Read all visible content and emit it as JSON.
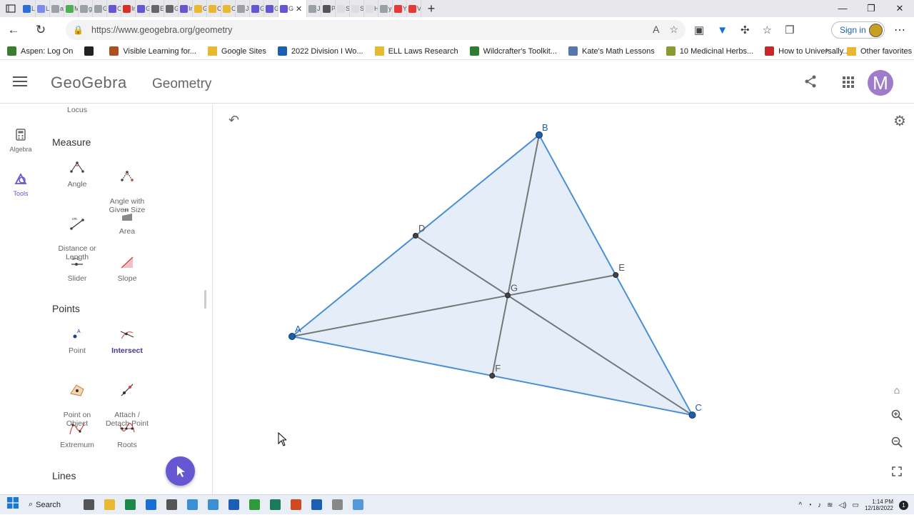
{
  "browser": {
    "tabs": [
      {
        "label": "Li",
        "color": "#2a6fd6"
      },
      {
        "label": "Li",
        "color": "#7a8cf0"
      },
      {
        "label": "ai",
        "color": "#9aa0a6"
      },
      {
        "label": "M",
        "color": "#4caf50"
      },
      {
        "label": "gi",
        "color": "#9aa0a6"
      },
      {
        "label": "G",
        "color": "#9aa0a6"
      },
      {
        "label": "Cl",
        "color": "#6557d2"
      },
      {
        "label": "In",
        "color": "#d93025"
      },
      {
        "label": "G",
        "color": "#6557d2"
      },
      {
        "label": "Ei",
        "color": "#666666"
      },
      {
        "label": "G",
        "color": "#666666"
      },
      {
        "label": "Ir",
        "color": "#6557d2"
      },
      {
        "label": "G",
        "color": "#e8b830"
      },
      {
        "label": "C",
        "color": "#e8b830"
      },
      {
        "label": "C",
        "color": "#e8b830"
      },
      {
        "label": "Jc",
        "color": "#9aa0a6"
      },
      {
        "label": "G",
        "color": "#6557d2"
      },
      {
        "label": "G",
        "color": "#6557d2"
      }
    ],
    "active_tab": {
      "label": "G",
      "close": "✕"
    },
    "tabs_after": [
      {
        "label": "Jc",
        "color": "#9aa0a6"
      },
      {
        "label": "Pi",
        "color": "#555555"
      },
      {
        "label": "S",
        "color": "#dddddd"
      },
      {
        "label": "S",
        "color": "#dddddd"
      },
      {
        "label": "H",
        "color": "#dddddd"
      },
      {
        "label": "yi",
        "color": "#9aa0a6"
      },
      {
        "label": "Yi",
        "color": "#e53935"
      },
      {
        "label": "V",
        "color": "#e53935"
      }
    ],
    "new_tab": "+",
    "window_controls": {
      "minimize": "—",
      "restore": "❐",
      "close": "✕"
    },
    "url": "https://www.geogebra.org/geometry",
    "sign_in": "Sign in",
    "bookmarks": [
      {
        "label": "Aspen: Log On",
        "color": "#3a7d2c"
      },
      {
        "label": "",
        "color": "#222222"
      },
      {
        "label": "Visible Learning for...",
        "color": "#b05020"
      },
      {
        "label": "Google Sites",
        "color": "#e8b830",
        "folder": true
      },
      {
        "label": "2022 Division I Wo...",
        "color": "#1a5fb4"
      },
      {
        "label": "ELL Laws Research",
        "color": "#e8b830",
        "folder": true
      },
      {
        "label": "Wildcrafter's Toolkit...",
        "color": "#2e7d32"
      },
      {
        "label": "Kate's Math Lessons",
        "color": "#5577aa"
      },
      {
        "label": "10 Medicinal Herbs...",
        "color": "#8a9a30"
      },
      {
        "label": "How to Universally...",
        "color": "#c62828"
      }
    ],
    "other_favorites": "Other favorites"
  },
  "app": {
    "logo": "GeoGebra",
    "title": "Geometry",
    "avatar_letter": "M"
  },
  "rail": {
    "algebra": "Algebra",
    "tools": "Tools"
  },
  "panel": {
    "top_cut_label": "Locus",
    "sections": {
      "measure": "Measure",
      "points": "Points",
      "lines": "Lines"
    },
    "measure_tools": [
      {
        "label": "Angle"
      },
      {
        "label": "Angle with\nGiven Size"
      },
      {
        "label": "Distance or\nLength"
      },
      {
        "label": "Area"
      },
      {
        "label": "Slider"
      },
      {
        "label": "Slope"
      }
    ],
    "point_tools": [
      {
        "label": "Point"
      },
      {
        "label": "Intersect",
        "selected": true
      },
      {
        "label": "Point on\nObject"
      },
      {
        "label": "Attach /\nDetach Point"
      },
      {
        "label": "Extremum"
      },
      {
        "label": "Roots"
      }
    ]
  },
  "construction": {
    "points": [
      {
        "label": "A",
        "x": 0,
        "y": 0
      },
      {
        "label": "B",
        "x": 10,
        "y": 8.2
      },
      {
        "label": "C",
        "x": 16.2,
        "y": -3.2
      },
      {
        "label": "D",
        "x": 5,
        "y": 4.1
      },
      {
        "label": "E",
        "x": 13.1,
        "y": 2.5
      },
      {
        "label": "F",
        "x": 8.1,
        "y": -1.6
      },
      {
        "label": "G",
        "x": 8.73,
        "y": 1.67
      }
    ],
    "polygon": [
      "A",
      "B",
      "C"
    ],
    "medians": [
      [
        "A",
        "E"
      ],
      [
        "B",
        "F"
      ],
      [
        "C",
        "D"
      ]
    ],
    "colors": {
      "triangle_fill": "#dce8f5",
      "edge": "#4a8fd4",
      "median": "#777777",
      "vertex": "#1f5fa6",
      "midpoint": "#444444"
    }
  },
  "taskbar": {
    "search": "Search",
    "apps": [
      "#555555",
      "#e8b830",
      "#1a8a4a",
      "#1a6fd6",
      "#555555",
      "#3a8fd6",
      "#3a8fd6",
      "#1a5fb4",
      "#2e9a3a",
      "#1a7a5a",
      "#d04a20",
      "#1a5fb4",
      "#888888",
      "#5599dd"
    ],
    "time": "1:14 PM",
    "date": "12/18/2022",
    "badge": "1"
  }
}
